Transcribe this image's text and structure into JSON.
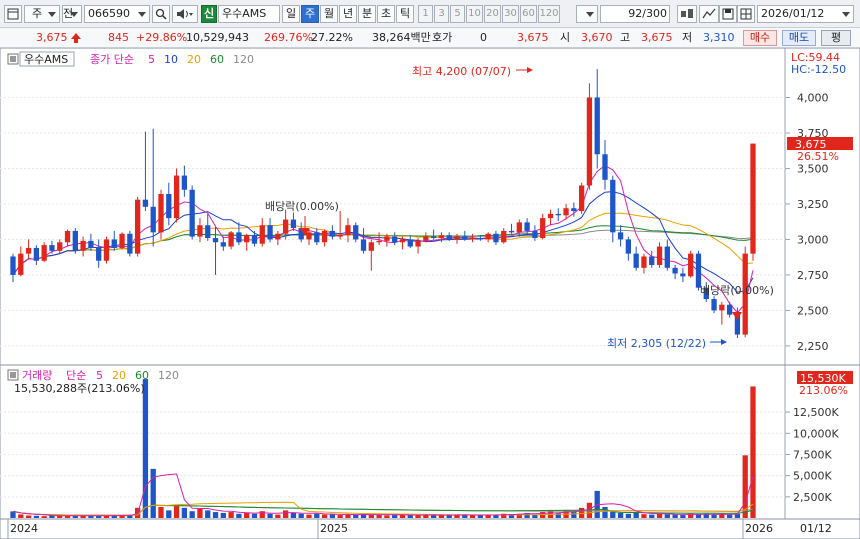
{
  "toolbar": {
    "kind": "주",
    "market": "전",
    "code": "066590",
    "badge": "신",
    "stock_name": "우수AMS",
    "periods": [
      "일",
      "주",
      "월",
      "년",
      "분",
      "초",
      "틱"
    ],
    "selected_period": "주",
    "intervals": [
      "1",
      "3",
      "5",
      "10",
      "20",
      "30",
      "60",
      "120"
    ],
    "count_value": "92",
    "count_total": "/300",
    "date": "2026/01/12"
  },
  "price": {
    "current": "3,675",
    "change": "845",
    "change_pct": "+29.86%",
    "volume": "10,529,943",
    "vol_ratio": "269.76%",
    "turnover": "27.22%",
    "amount": "38,264백만",
    "quote_label": "호가",
    "quote_value": "0",
    "quote_price": "3,675",
    "open_label": "시",
    "open_value": "3,670",
    "high_label": "고",
    "high_value": "3,675",
    "low_label": "저",
    "low_value": "3,310",
    "buy_button": "매수",
    "sell_button": "매도",
    "eval_button": "평"
  },
  "price_panel": {
    "legend_name": "우수AMS",
    "legend_ma_prefix": "종가 단순",
    "legend_ma": [
      {
        "label": "5",
        "color": "#d81fb0"
      },
      {
        "label": "10",
        "color": "#1a3fcf"
      },
      {
        "label": "20",
        "color": "#e8a100"
      },
      {
        "label": "60",
        "color": "#1a8a2a"
      },
      {
        "label": "120",
        "color": "#8a8a8a"
      }
    ],
    "lc_label": "LC:59.44",
    "hc_label": "HC:-12.50",
    "current_tag": "3,675",
    "current_pct_tag": "26.51%",
    "high_annotation": "최고 4,200 (07/07)",
    "low_annotation": "최저 2,305 (12/22)",
    "dividend_1": "배당락(0.00%)",
    "dividend_2": "배당락(0.00%)",
    "y_ticks": [
      "4,000",
      "3,750",
      "3,500",
      "3,250",
      "3,000",
      "2,750",
      "2,500",
      "2,250"
    ]
  },
  "volume_panel": {
    "legend_title": "거래량",
    "legend_ma_prefix": "단순",
    "legend_ma": [
      {
        "label": "5",
        "color": "#d81fb0"
      },
      {
        "label": "20",
        "color": "#e8a100"
      },
      {
        "label": "60",
        "color": "#1a8a2a"
      },
      {
        "label": "120",
        "color": "#8a8a8a"
      }
    ],
    "current_text": "15,530,288주(213.06%)",
    "current_tag": "15,530K",
    "current_pct_tag": "213.06%",
    "y_ticks": [
      "12,500K",
      "10,000K",
      "7,500K",
      "5,000K",
      "2,500K"
    ]
  },
  "x_axis": {
    "labels": [
      "2024",
      "2025",
      "2026"
    ],
    "right_label": "01/12"
  },
  "colors": {
    "up": "#e1261c",
    "down": "#1e56c8",
    "ma5": "#d81fb0",
    "ma10": "#1a3fcf",
    "ma20": "#e8a100",
    "ma60": "#1a8a2a",
    "ma120": "#8a8a8a"
  },
  "chart_data": {
    "type": "candlestick",
    "interval": "weekly",
    "price_ylim": [
      2200,
      4250
    ],
    "volume_ylim": [
      0,
      17000
    ],
    "ohlc": [
      [
        2880,
        2900,
        2700,
        2750
      ],
      [
        2750,
        2950,
        2740,
        2900
      ],
      [
        2900,
        3000,
        2860,
        2940
      ],
      [
        2940,
        2960,
        2820,
        2850
      ],
      [
        2850,
        2980,
        2840,
        2960
      ],
      [
        2960,
        2990,
        2900,
        2920
      ],
      [
        2920,
        3000,
        2900,
        2980
      ],
      [
        2980,
        3070,
        2950,
        3060
      ],
      [
        3060,
        3080,
        2900,
        2920
      ],
      [
        2920,
        3020,
        2880,
        2990
      ],
      [
        2990,
        3040,
        2920,
        2940
      ],
      [
        2940,
        3000,
        2800,
        2850
      ],
      [
        2850,
        3020,
        2830,
        3000
      ],
      [
        3000,
        3060,
        2920,
        2940
      ],
      [
        2940,
        3050,
        2930,
        3040
      ],
      [
        3040,
        3060,
        2880,
        2900
      ],
      [
        2900,
        3300,
        2880,
        3280
      ],
      [
        3280,
        3760,
        3200,
        3230
      ],
      [
        3230,
        3780,
        2950,
        3050
      ],
      [
        3050,
        3350,
        3000,
        3320
      ],
      [
        3320,
        3400,
        3100,
        3150
      ],
      [
        3150,
        3500,
        3120,
        3450
      ],
      [
        3450,
        3520,
        3300,
        3350
      ],
      [
        3350,
        3380,
        3000,
        3020
      ],
      [
        3020,
        3150,
        2980,
        3100
      ],
      [
        3100,
        3180,
        2990,
        3010
      ],
      [
        3010,
        3090,
        2750,
        2980
      ],
      [
        2980,
        3020,
        2920,
        2950
      ],
      [
        2950,
        3060,
        2930,
        3050
      ],
      [
        3050,
        3120,
        2960,
        2980
      ],
      [
        2980,
        3040,
        2920,
        3030
      ],
      [
        3030,
        3060,
        2950,
        2970
      ],
      [
        2970,
        3150,
        2950,
        3100
      ],
      [
        3100,
        3150,
        2980,
        3000
      ],
      [
        3000,
        3060,
        2960,
        3040
      ],
      [
        3040,
        3210,
        3000,
        3140
      ],
      [
        3140,
        3190,
        3060,
        3080
      ],
      [
        3080,
        3120,
        2980,
        3000
      ],
      [
        3000,
        3070,
        2960,
        3050
      ],
      [
        3050,
        3080,
        2960,
        2980
      ],
      [
        2980,
        3070,
        2950,
        3060
      ],
      [
        3060,
        3100,
        3000,
        3020
      ],
      [
        3020,
        3200,
        3000,
        3030
      ],
      [
        3030,
        3150,
        2980,
        3100
      ],
      [
        3100,
        3120,
        2980,
        3000
      ],
      [
        3000,
        3080,
        2900,
        2920
      ],
      [
        2920,
        3000,
        2780,
        2980
      ],
      [
        2980,
        3050,
        2960,
        2990
      ],
      [
        2990,
        3040,
        2950,
        3020
      ],
      [
        3020,
        3050,
        2960,
        2980
      ],
      [
        2980,
        3020,
        2930,
        3000
      ],
      [
        3000,
        3030,
        2940,
        2950
      ],
      [
        2950,
        3010,
        2900,
        2990
      ],
      [
        2990,
        3050,
        2980,
        3020
      ],
      [
        3020,
        3070,
        3000,
        3010
      ],
      [
        3010,
        3050,
        2980,
        3030
      ],
      [
        3030,
        3050,
        2990,
        3000
      ],
      [
        3000,
        3040,
        2970,
        3020
      ],
      [
        3020,
        3060,
        2990,
        3000
      ],
      [
        3000,
        3040,
        2980,
        3010
      ],
      [
        3010,
        3030,
        2990,
        3000
      ],
      [
        3000,
        3050,
        2980,
        3040
      ],
      [
        3040,
        3060,
        2960,
        2980
      ],
      [
        2980,
        3080,
        2970,
        3060
      ],
      [
        3060,
        3110,
        3040,
        3050
      ],
      [
        3050,
        3140,
        3020,
        3120
      ],
      [
        3120,
        3150,
        3040,
        3060
      ],
      [
        3060,
        3100,
        2990,
        3010
      ],
      [
        3010,
        3180,
        3000,
        3150
      ],
      [
        3150,
        3210,
        3100,
        3180
      ],
      [
        3180,
        3220,
        3130,
        3170
      ],
      [
        3170,
        3250,
        3140,
        3220
      ],
      [
        3220,
        3260,
        3160,
        3200
      ],
      [
        3200,
        3400,
        3180,
        3380
      ],
      [
        3380,
        4100,
        3350,
        4000
      ],
      [
        4000,
        4200,
        3500,
        3600
      ],
      [
        3600,
        3700,
        3350,
        3420
      ],
      [
        3420,
        3450,
        2980,
        3050
      ],
      [
        3050,
        3100,
        2950,
        3000
      ],
      [
        3000,
        3020,
        2850,
        2900
      ],
      [
        2900,
        2950,
        2780,
        2800
      ],
      [
        2800,
        2900,
        2760,
        2880
      ],
      [
        2880,
        2920,
        2800,
        2820
      ],
      [
        2820,
        2980,
        2800,
        2950
      ],
      [
        2950,
        3000,
        2780,
        2800
      ],
      [
        2800,
        2820,
        2720,
        2760
      ],
      [
        2760,
        2800,
        2700,
        2740
      ],
      [
        2740,
        2920,
        2730,
        2900
      ],
      [
        2900,
        2920,
        2640,
        2660
      ],
      [
        2660,
        2700,
        2560,
        2580
      ],
      [
        2580,
        2600,
        2480,
        2500
      ],
      [
        2500,
        2560,
        2400,
        2540
      ],
      [
        2540,
        2560,
        2450,
        2470
      ],
      [
        2470,
        2520,
        2305,
        2330
      ],
      [
        2330,
        2950,
        2310,
        2900
      ],
      [
        2900,
        3675,
        2850,
        3675
      ]
    ],
    "volume": [
      780,
      420,
      300,
      260,
      220,
      300,
      260,
      280,
      240,
      260,
      280,
      300,
      260,
      320,
      280,
      340,
      1200,
      16400,
      5800,
      1300,
      900,
      1600,
      1200,
      800,
      1100,
      900,
      700,
      600,
      700,
      500,
      600,
      500,
      800,
      500,
      400,
      900,
      600,
      500,
      400,
      500,
      400,
      500,
      350,
      400,
      380,
      450,
      400,
      350,
      300,
      400,
      380,
      350,
      300,
      350,
      400,
      300,
      350,
      400,
      380,
      300,
      350,
      320,
      400,
      500,
      450,
      500,
      600,
      400,
      700,
      800,
      600,
      900,
      700,
      1200,
      1800,
      3200,
      1300,
      900,
      600,
      500,
      700,
      450,
      400,
      500,
      450,
      400,
      350,
      500,
      450,
      500,
      400,
      450,
      400,
      500,
      7400,
      15530
    ]
  }
}
